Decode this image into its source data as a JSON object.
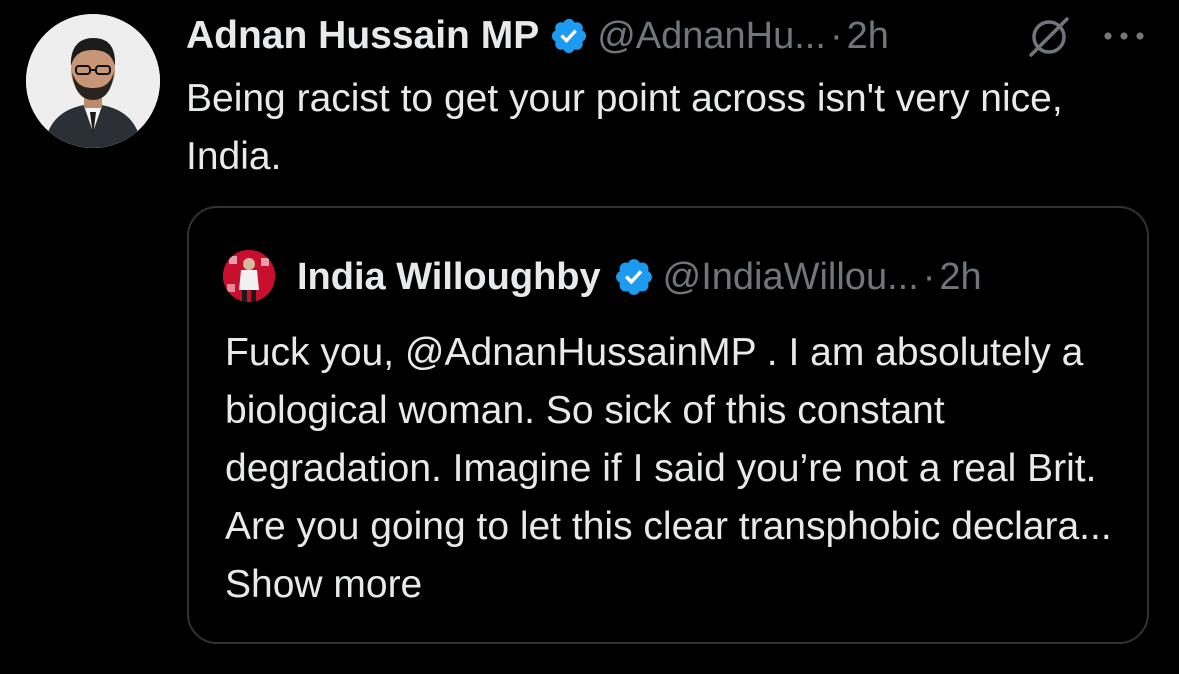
{
  "tweet": {
    "author_name": "Adnan Hussain MP",
    "handle": "@AdnanHu...",
    "separator": "·",
    "time": "2h",
    "text": "Being racist to get your point across isn't very nice, India.",
    "verified_icon": "verified-badge-icon",
    "grok_icon": "grok-icon",
    "more_icon": "more-icon"
  },
  "quote": {
    "author_name": "India Willoughby",
    "handle": "@IndiaWillou...",
    "separator": "·",
    "time": "2h",
    "text": "Fuck you, @AdnanHussainMP . I am absolutely a biological woman. So sick of this constant degradation. Imagine if I said you’re not a real Brit. Are you going to let this clear transphobic declara...",
    "show_more": "Show more"
  },
  "colors": {
    "background": "#000000",
    "text_primary": "#e7e9ea",
    "text_secondary": "#71767b",
    "border": "#2f3336",
    "verified": "#1d9bf0"
  }
}
